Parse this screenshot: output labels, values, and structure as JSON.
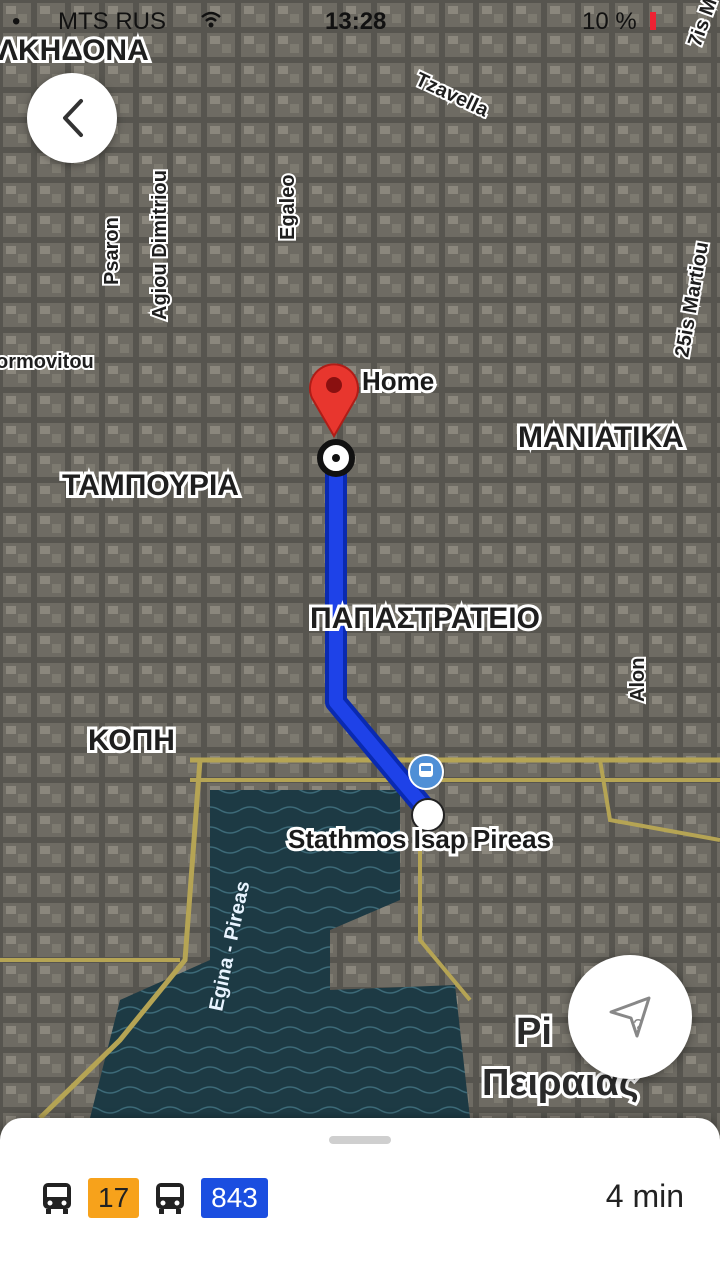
{
  "status_bar": {
    "carrier": "MTS RUS",
    "time": "13:28",
    "battery": "10 %"
  },
  "map": {
    "areas": [
      "ΛΚΗΔΟΝΑ",
      "ΤΑΜΠΟΥΡΙΑ",
      "ΠΑΠΑΣΤΡΑΤΕΙΟ",
      "ΜΑΝΙΑΤΙΚΑ",
      "ΚΟΠΗ",
      "Πειραιας",
      "Pi"
    ],
    "streets": [
      "Tzavella",
      "Psaron",
      "Agiou Dimitriou",
      "Egaleo",
      "ormovitou",
      "25is Martiou",
      "Alon",
      "Egina - Pireas",
      "7is M"
    ],
    "destination_label": "Home",
    "station_label": "Stathmos Isap Pireas"
  },
  "buttons": {
    "back": "chevron-left-icon",
    "location": "location-question-icon"
  },
  "bottom_sheet": {
    "routes": [
      {
        "icon": "bus-icon",
        "number": "17",
        "color": "#f7a21b"
      },
      {
        "icon": "bus-icon",
        "number": "843",
        "color": "#1b4ee0"
      }
    ],
    "duration": "4 min"
  }
}
